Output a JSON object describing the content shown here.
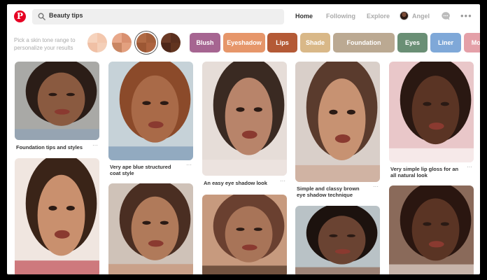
{
  "header": {
    "logo": "P",
    "search_value": "Beauty tips",
    "nav": [
      "Home",
      "Following",
      "Explore"
    ],
    "user_name": "Angel",
    "more": "•••"
  },
  "filters": {
    "tone_prompt": "Pick a skin tone range to personalize your results",
    "swatches": [
      {
        "colors": [
          "#f6d3bd",
          "#f3c7ad",
          "#f0c0a5",
          "#f4cfb8"
        ]
      },
      {
        "colors": [
          "#e8a88a",
          "#d99070",
          "#c98663",
          "#e3a07f"
        ]
      },
      {
        "colors": [
          "#b06a44",
          "#a35e3a",
          "#9c5734",
          "#ad6440"
        ],
        "selected": true
      },
      {
        "colors": [
          "#6b3a26",
          "#5a2f1e",
          "#4e2719",
          "#62341f"
        ]
      }
    ],
    "chips": [
      {
        "label": "Blush",
        "color": "#a66591"
      },
      {
        "label": "Eyeshadow",
        "color": "#e6966a"
      },
      {
        "label": "Lips",
        "color": "#b45a36"
      },
      {
        "label": "Shade",
        "color": "#d9b888"
      },
      {
        "label": "Foundation",
        "color": "#bba992"
      },
      {
        "label": "Eyes",
        "color": "#6a8f75"
      },
      {
        "label": "Liner",
        "color": "#7fa8d8"
      },
      {
        "label": "Moo",
        "color": "#e4a0a8"
      }
    ]
  },
  "pins": [
    {
      "title": "Foundation tips and styles",
      "more": "···",
      "palette": [
        "#a9a9a6",
        "#2b1d17",
        "#8a5a40",
        "#8aa2bb"
      ]
    },
    {
      "title": "Very ape blue structured coat style",
      "more": "···",
      "palette": [
        "#c6d2d8",
        "#8b4a2a",
        "#a96a48",
        "#6f8fb0"
      ]
    },
    {
      "title": "An easy eye shadow look",
      "more": "···",
      "palette": [
        "#e6ddd8",
        "#3a2a22",
        "#b8846a",
        "#f0e8e4"
      ]
    },
    {
      "title": "Simple and classy brown eye shadow technique",
      "more": "···",
      "palette": [
        "#d9cfc9",
        "#5a3b2d",
        "#c79272",
        "#caa08a"
      ]
    },
    {
      "title": "Very simple lip gloss for an all natural look",
      "more": "···",
      "palette": [
        "#e9c7c9",
        "#2a1812",
        "#5a3424",
        "#ffffff"
      ]
    },
    {
      "title": "",
      "more": "",
      "palette": [
        "#f0e6e0",
        "#3a2418",
        "#c9906e",
        "#b8303a"
      ]
    },
    {
      "title": "",
      "more": "",
      "palette": [
        "#cfc2b8",
        "#4a2e22",
        "#b07a5a",
        "#c58a6a"
      ]
    },
    {
      "title": "",
      "more": "",
      "palette": [
        "#c79a7e",
        "#6a4030",
        "#a87458",
        "#3a2418"
      ]
    },
    {
      "title": "",
      "more": "",
      "palette": [
        "#b9c2c6",
        "#1c120e",
        "#6a4332",
        "#8a5a44"
      ]
    },
    {
      "title": "",
      "more": "",
      "palette": [
        "#8a6a5a",
        "#2a1610",
        "#5a3424",
        "#f0e6e0"
      ]
    }
  ]
}
